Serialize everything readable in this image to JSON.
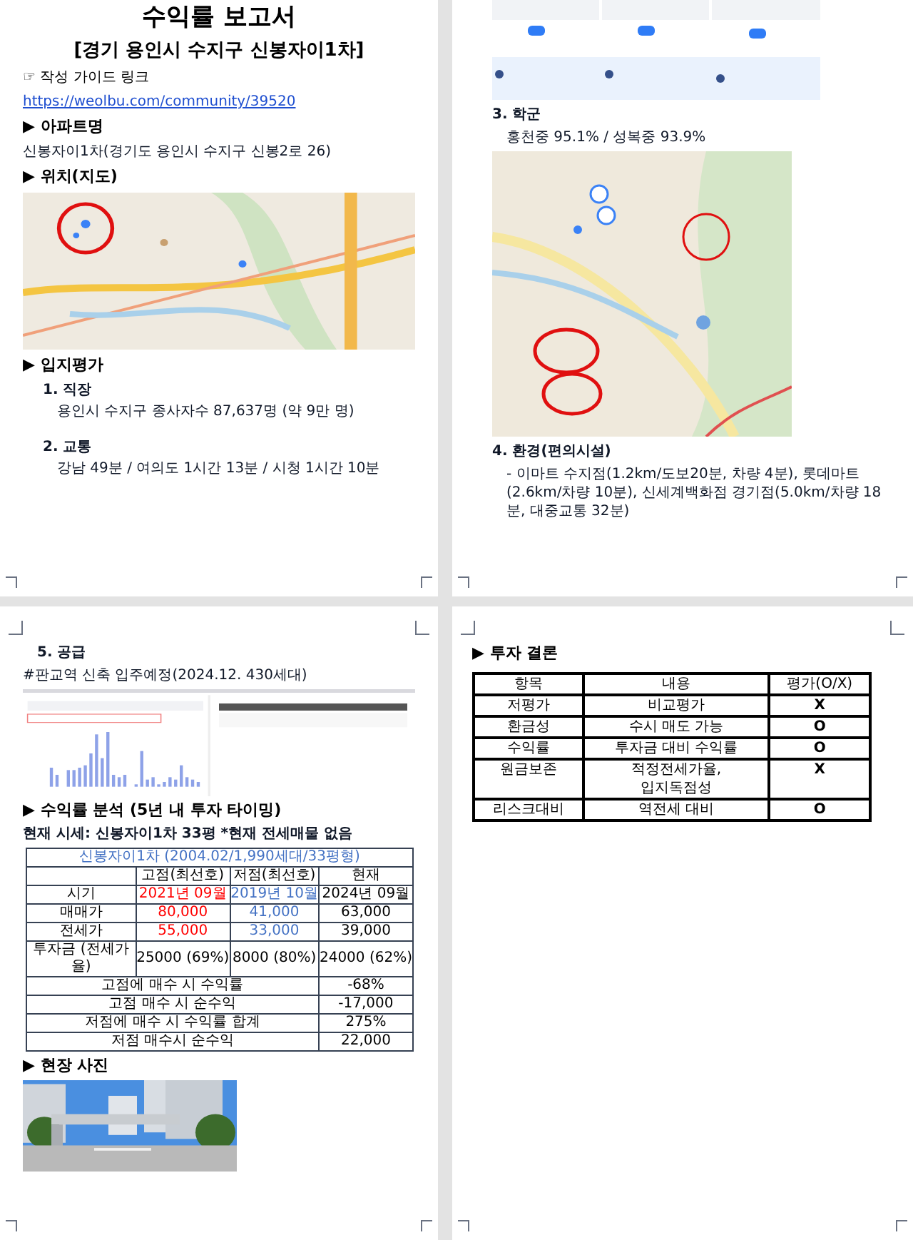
{
  "page1": {
    "title": "수익률 보고서",
    "subtitle": "[경기 용인시 수지구 신봉자이1차]",
    "guide": {
      "label": "☞ 작성 가이드 링크",
      "link": "https://weolbu.com/community/39520"
    },
    "apartment": {
      "heading": "▶ 아파트명",
      "text": "신봉자이1차(경기도 용인시 수지구 신봉2로 26)"
    },
    "location": {
      "heading": "▶ 위치(지도)"
    },
    "evaluation": {
      "heading": "▶ 입지평가",
      "items": [
        {
          "title": "1. 직장",
          "text": "용인시 수지구 종사자수 87,637명 (약 9만 명)"
        },
        {
          "title": "2. 교통",
          "text": "강남 49분 / 여의도 1시간 13분 / 시청 1시간 10분"
        }
      ]
    }
  },
  "page2": {
    "items": [
      {
        "title": "3. 학군",
        "text": "홍천중 95.1% / 성복중 93.9%"
      },
      {
        "title": "4. 환경(편의시설)",
        "text": "- 이마트 수지점(1.2km/도보20분, 차량 4분), 롯데마트(2.6km/차량 10분), 신세계백화점 경기점(5.0km/차량 18분, 대중교통 32분)"
      }
    ]
  },
  "page3": {
    "supply": {
      "title": "5. 공급",
      "text": "#판교역 신축 입주예정(2024.12. 430세대)"
    },
    "returns": {
      "heading": "▶ 수익률 분석 (5년 내 투자 타이밍)",
      "note": "현재 시세: 신봉자이1차 33평 *현재 전세매물 없음",
      "table": {
        "title": "신봉자이1차 (2004.02/1,990세대/33평형)",
        "columns": [
          {
            "label": "고점(최선호)",
            "color": "#ff0000"
          },
          {
            "label": "저점(최선호)",
            "color": "#4472c4"
          },
          {
            "label": "현재",
            "color": "#000000"
          }
        ],
        "rows": [
          {
            "label": "시기",
            "colored": true,
            "cells": [
              "2021년 09월",
              "2019년 10월",
              "2024년 09월"
            ]
          },
          {
            "label": "매매가",
            "colored": true,
            "cells": [
              "80,000",
              "41,000",
              "63,000"
            ]
          },
          {
            "label": "전세가",
            "colored": true,
            "cells": [
              "55,000",
              "33,000",
              "39,000"
            ]
          },
          {
            "label": "투자금 (전세가율)",
            "colored": false,
            "cells": [
              "25000 (69%)",
              "8000 (80%)",
              "24000 (62%)"
            ]
          }
        ],
        "summary": [
          {
            "label": "고점에 매수 시 수익률",
            "value": "-68%"
          },
          {
            "label": "고점 매수 시 순수익",
            "value": "-17,000"
          },
          {
            "label": "저점에 매수 시 수익률 합계",
            "value": "275%"
          },
          {
            "label": "저점 매수시 순수익",
            "value": "22,000"
          }
        ]
      }
    },
    "photos": {
      "heading": "▶ 현장 사진"
    }
  },
  "page4": {
    "heading": "▶ 투자 결론",
    "table": {
      "columns": [
        "항목",
        "내용",
        "평가(O/X)"
      ],
      "rows": [
        {
          "item": "저평가",
          "content": [
            "비교평가"
          ],
          "rating": "X"
        },
        {
          "item": "환금성",
          "content": [
            "수시 매도 가능"
          ],
          "rating": "O"
        },
        {
          "item": "수익률",
          "content": [
            "투자금 대비 수익률"
          ],
          "rating": "O"
        },
        {
          "item": "원금보존",
          "content": [
            "적정전세가율,",
            "입지독점성"
          ],
          "rating": "X"
        },
        {
          "item": "리스크대비",
          "content": [
            "역전세 대비"
          ],
          "rating": "O"
        }
      ]
    }
  }
}
